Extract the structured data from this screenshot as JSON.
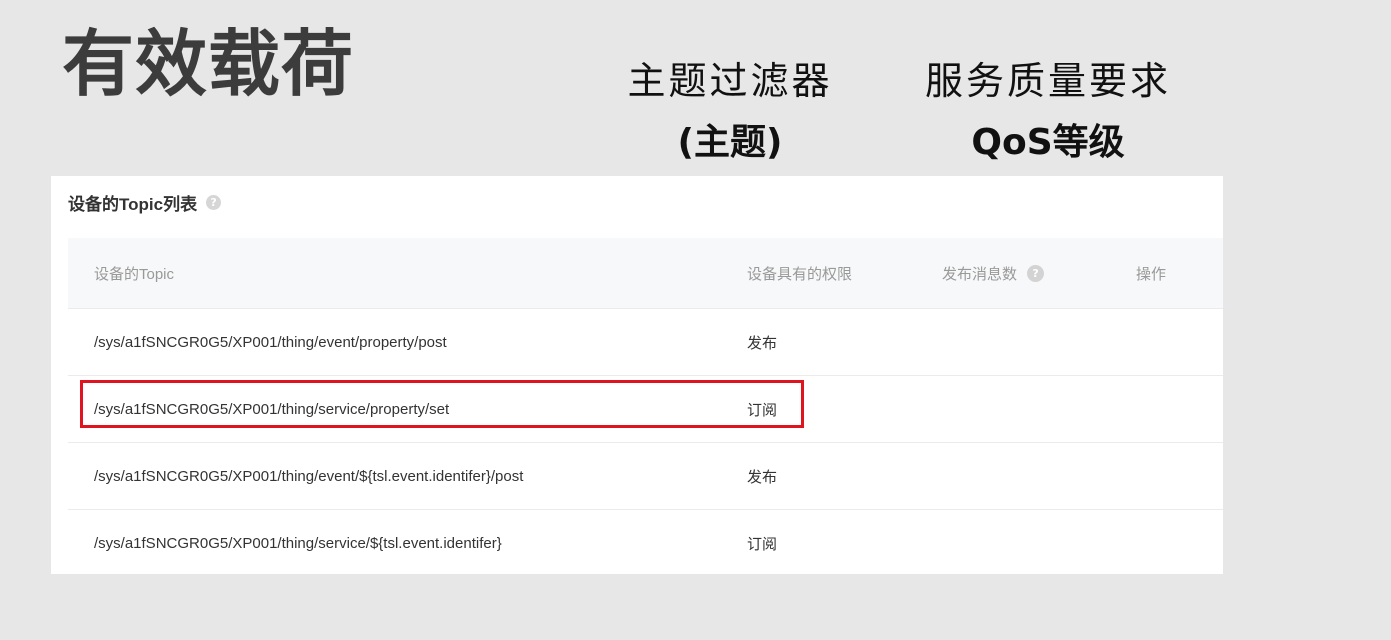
{
  "slide": {
    "title": "有效载荷",
    "topic_filter_label": "主题过滤器",
    "topic_filter_sub": "(主题)",
    "qos_label": "服务质量要求",
    "qos_sub": "QoS等级"
  },
  "panel": {
    "title": "设备的Topic列表",
    "help_glyph": "?",
    "columns": {
      "topic": "设备的Topic",
      "permission": "设备具有的权限",
      "publish_count": "发布消息数",
      "operation": "操作"
    },
    "rows": [
      {
        "topic": "/sys/a1fSNCGR0G5/XP001/thing/event/property/post",
        "permission": "发布"
      },
      {
        "topic": "/sys/a1fSNCGR0G5/XP001/thing/service/property/set",
        "permission": "订阅"
      },
      {
        "topic": "/sys/a1fSNCGR0G5/XP001/thing/event/${tsl.event.identifer}/post",
        "permission": "发布"
      },
      {
        "topic": "/sys/a1fSNCGR0G5/XP001/thing/service/${tsl.event.identifer}",
        "permission": "订阅"
      }
    ]
  },
  "colors": {
    "background": "#e7e7e7",
    "title": "#3c3c3c",
    "highlight": "#e0141e",
    "header_bg": "#f7f8f9"
  }
}
